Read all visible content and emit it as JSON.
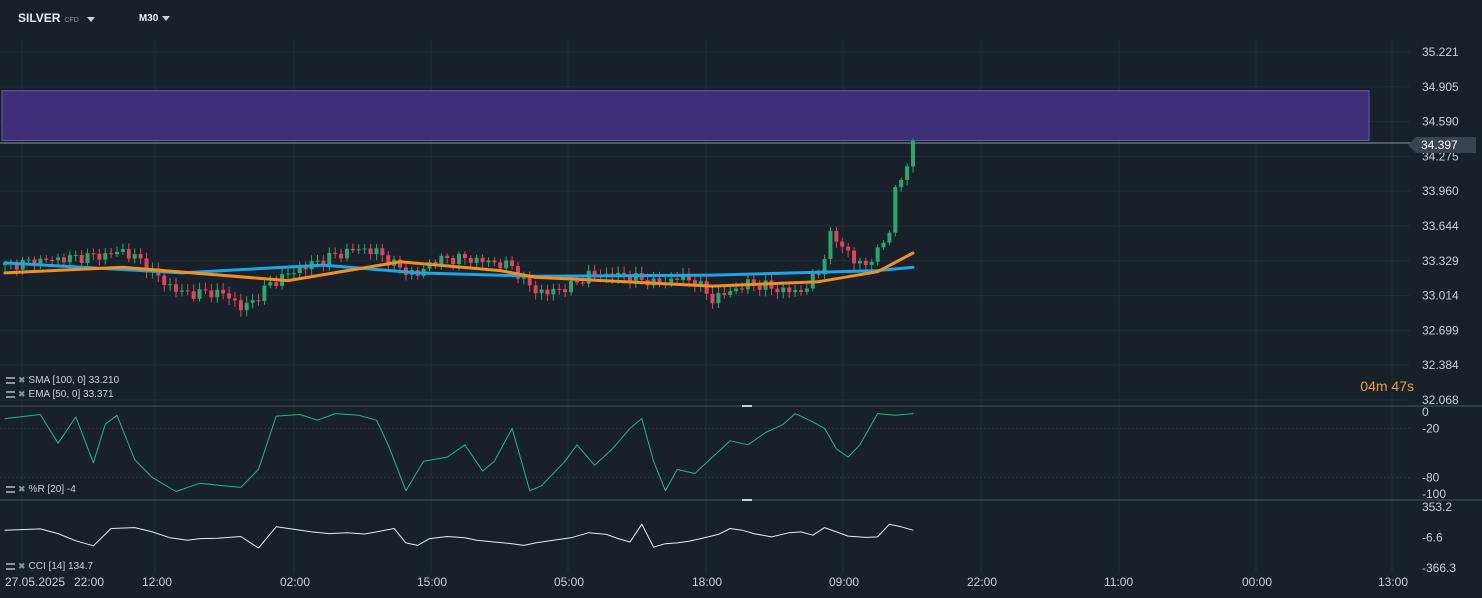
{
  "symbol": {
    "name": "SILVER",
    "badge": "CFD"
  },
  "timeframe": "M30",
  "countdown": "04m 47s",
  "current_price": "34.397",
  "colors": {
    "bg": "#18212a",
    "zone": "#3f2f78",
    "sma": "#1ea5e6",
    "ema": "#f0901e",
    "up": "#26a96b",
    "down": "#e0455a"
  },
  "indicators": {
    "sma": {
      "label": "SMA [100, 0] 33.210"
    },
    "ema": {
      "label": "EMA [50, 0] 33.371"
    },
    "wr": {
      "label": "%R [20] -4"
    },
    "cci": {
      "label": "CCI [14] 134.7"
    }
  },
  "chart_data": [
    {
      "type": "candlestick",
      "title": "SILVER M30",
      "y_ticks": [
        "35.221",
        "34.905",
        "34.590",
        "34.275",
        "33.960",
        "33.644",
        "33.329",
        "33.014",
        "32.699",
        "32.384",
        "32.068"
      ],
      "ylim": [
        32.068,
        35.221
      ],
      "x_ticks": [
        "27.05.2025",
        "22:00",
        "12:00",
        "02:00",
        "15:00",
        "05:00",
        "18:00",
        "09:00",
        "22:00",
        "11:00",
        "00:00",
        "13:00"
      ],
      "zone": {
        "from": 34.42,
        "to": 34.87
      },
      "close_path": [
        [
          0,
          33.29
        ],
        [
          6,
          33.33
        ],
        [
          12,
          33.36
        ],
        [
          17,
          33.38
        ],
        [
          20,
          33.42
        ],
        [
          23,
          33.33
        ],
        [
          26,
          33.18
        ],
        [
          29,
          33.06
        ],
        [
          32,
          33.03
        ],
        [
          35,
          33.05
        ],
        [
          38,
          33.01
        ],
        [
          40,
          32.9
        ],
        [
          42,
          32.96
        ],
        [
          45,
          33.12
        ],
        [
          48,
          33.21
        ],
        [
          52,
          33.3
        ],
        [
          56,
          33.38
        ],
        [
          60,
          33.44
        ],
        [
          63,
          33.41
        ],
        [
          67,
          33.26
        ],
        [
          70,
          33.2
        ],
        [
          72,
          33.31
        ],
        [
          75,
          33.35
        ],
        [
          78,
          33.35
        ],
        [
          82,
          33.32
        ],
        [
          86,
          33.28
        ],
        [
          88,
          33.15
        ],
        [
          90,
          33.06
        ],
        [
          92,
          33.04
        ],
        [
          96,
          33.1
        ],
        [
          99,
          33.2
        ],
        [
          103,
          33.2
        ],
        [
          108,
          33.16
        ],
        [
          111,
          33.12
        ],
        [
          114,
          33.18
        ],
        [
          117,
          33.15
        ],
        [
          120,
          32.98
        ],
        [
          122,
          33.03
        ],
        [
          126,
          33.12
        ],
        [
          129,
          33.1
        ],
        [
          132,
          33.06
        ],
        [
          135,
          33.05
        ],
        [
          138,
          33.22
        ],
        [
          140,
          33.55
        ],
        [
          142,
          33.48
        ],
        [
          144,
          33.32
        ],
        [
          146,
          33.3
        ],
        [
          148,
          33.4
        ],
        [
          150,
          33.62
        ],
        [
          151,
          33.95
        ],
        [
          153,
          34.2
        ],
        [
          154,
          34.4
        ]
      ],
      "series": [
        {
          "name": "SMA [100, 0]",
          "values": [
            [
              0,
              33.31
            ],
            [
              30,
              33.22
            ],
            [
              54,
              33.29
            ],
            [
              70,
              33.22
            ],
            [
              90,
              33.19
            ],
            [
              120,
              33.2
            ],
            [
              148,
              33.24
            ],
            [
              154,
              33.27
            ]
          ]
        },
        {
          "name": "EMA [50, 0]",
          "values": [
            [
              0,
              33.22
            ],
            [
              20,
              33.27
            ],
            [
              48,
              33.15
            ],
            [
              67,
              33.32
            ],
            [
              84,
              33.24
            ],
            [
              90,
              33.18
            ],
            [
              120,
              33.1
            ],
            [
              138,
              33.14
            ],
            [
              148,
              33.23
            ],
            [
              154,
              33.4
            ]
          ]
        }
      ]
    },
    {
      "type": "line",
      "name": "%R [20]",
      "y_ticks": [
        "0",
        "-20",
        "-80",
        "-100"
      ],
      "ylim": [
        -100,
        0
      ],
      "values": [
        [
          0,
          -8
        ],
        [
          6,
          -3
        ],
        [
          9,
          -38
        ],
        [
          12,
          -6
        ],
        [
          15,
          -62
        ],
        [
          17,
          -15
        ],
        [
          19,
          -4
        ],
        [
          22,
          -58
        ],
        [
          25,
          -80
        ],
        [
          29,
          -97
        ],
        [
          33,
          -87
        ],
        [
          37,
          -90
        ],
        [
          40,
          -92
        ],
        [
          43,
          -70
        ],
        [
          46,
          -5
        ],
        [
          50,
          -3
        ],
        [
          53,
          -10
        ],
        [
          56,
          -2
        ],
        [
          60,
          -4
        ],
        [
          63,
          -10
        ],
        [
          65,
          -40
        ],
        [
          68,
          -96
        ],
        [
          71,
          -60
        ],
        [
          75,
          -55
        ],
        [
          78,
          -40
        ],
        [
          81,
          -72
        ],
        [
          83,
          -60
        ],
        [
          86,
          -20
        ],
        [
          89,
          -96
        ],
        [
          91,
          -90
        ],
        [
          93,
          -75
        ],
        [
          95,
          -60
        ],
        [
          97,
          -40
        ],
        [
          100,
          -65
        ],
        [
          103,
          -45
        ],
        [
          106,
          -20
        ],
        [
          108,
          -8
        ],
        [
          110,
          -60
        ],
        [
          112,
          -96
        ],
        [
          114,
          -70
        ],
        [
          117,
          -75
        ],
        [
          120,
          -55
        ],
        [
          123,
          -35
        ],
        [
          126,
          -40
        ],
        [
          129,
          -25
        ],
        [
          132,
          -15
        ],
        [
          134,
          -2
        ],
        [
          137,
          -12
        ],
        [
          139,
          -20
        ],
        [
          141,
          -45
        ],
        [
          143,
          -55
        ],
        [
          145,
          -40
        ],
        [
          148,
          -2
        ],
        [
          151,
          -4
        ],
        [
          154,
          -2
        ]
      ]
    },
    {
      "type": "line",
      "name": "CCI [14]",
      "y_ticks": [
        "353.2",
        "-6.6",
        "-366.3"
      ],
      "ylim": [
        -366.3,
        353.2
      ],
      "values": [
        [
          0,
          80
        ],
        [
          6,
          95
        ],
        [
          9,
          40
        ],
        [
          12,
          -45
        ],
        [
          15,
          -105
        ],
        [
          18,
          100
        ],
        [
          22,
          110
        ],
        [
          25,
          60
        ],
        [
          28,
          -10
        ],
        [
          31,
          -40
        ],
        [
          33,
          -20
        ],
        [
          36,
          -15
        ],
        [
          40,
          5
        ],
        [
          43,
          -130
        ],
        [
          46,
          120
        ],
        [
          49,
          90
        ],
        [
          52,
          60
        ],
        [
          55,
          40
        ],
        [
          58,
          50
        ],
        [
          61,
          35
        ],
        [
          63,
          60
        ],
        [
          66,
          100
        ],
        [
          68,
          -70
        ],
        [
          70,
          -100
        ],
        [
          72,
          -20
        ],
        [
          75,
          5
        ],
        [
          78,
          -10
        ],
        [
          80,
          -40
        ],
        [
          83,
          -60
        ],
        [
          86,
          -80
        ],
        [
          88,
          -100
        ],
        [
          90,
          -70
        ],
        [
          93,
          -40
        ],
        [
          96,
          -10
        ],
        [
          99,
          50
        ],
        [
          102,
          30
        ],
        [
          104,
          -20
        ],
        [
          106,
          -60
        ],
        [
          108,
          150
        ],
        [
          110,
          -120
        ],
        [
          112,
          -80
        ],
        [
          114,
          -70
        ],
        [
          116,
          -50
        ],
        [
          118,
          -20
        ],
        [
          121,
          30
        ],
        [
          123,
          100
        ],
        [
          125,
          80
        ],
        [
          127,
          40
        ],
        [
          130,
          0
        ],
        [
          133,
          50
        ],
        [
          135,
          60
        ],
        [
          137,
          20
        ],
        [
          139,
          110
        ],
        [
          141,
          60
        ],
        [
          143,
          10
        ],
        [
          146,
          -5
        ],
        [
          148,
          0
        ],
        [
          150,
          150
        ],
        [
          152,
          120
        ],
        [
          154,
          80
        ]
      ]
    }
  ]
}
